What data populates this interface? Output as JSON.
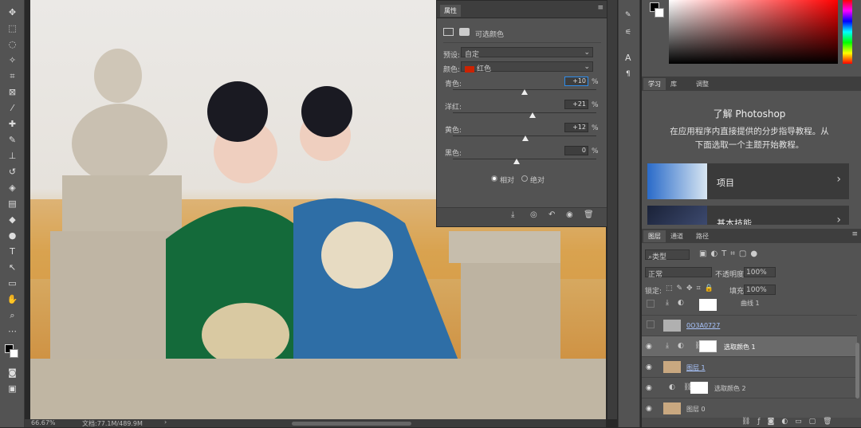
{
  "canvas": {
    "zoom": "66.67%",
    "doc": "文档:77.1M/489.9M"
  },
  "properties": {
    "tab": "属性",
    "title": "可选颜色",
    "preset_label": "预设:",
    "preset_value": "自定",
    "color_label": "颜色:",
    "color_value": "红色",
    "sliders": [
      {
        "label": "青色:",
        "value": "+10",
        "pct": "%"
      },
      {
        "label": "洋红:",
        "value": "+21",
        "pct": "%"
      },
      {
        "label": "黄色:",
        "value": "+12",
        "pct": "%"
      },
      {
        "label": "黑色:",
        "value": "0",
        "pct": "%"
      }
    ],
    "radio_relative": "相对",
    "radio_absolute": "绝对"
  },
  "learn": {
    "tabs": [
      "学习",
      "库",
      "调整"
    ],
    "heading": "了解 Photoshop",
    "desc_line1": "在应用程序内直接提供的分步指导教程。从",
    "desc_line2": "下面选取一个主题开始教程。",
    "cards": [
      {
        "label": "项目"
      },
      {
        "label": "基本技能"
      }
    ]
  },
  "layers": {
    "tabs": [
      "图层",
      "通道",
      "路径"
    ],
    "filter": "类型",
    "blend": "正常",
    "opacity_label": "不透明度:",
    "opacity": "100%",
    "lock_label": "锁定:",
    "fill_label": "填充:",
    "fill": "100%",
    "rows": [
      {
        "name": "曲线 1"
      },
      {
        "name": "0O3A0727"
      },
      {
        "name": "选取颜色 1"
      },
      {
        "name": "图层 1"
      },
      {
        "name": "选取颜色 2"
      },
      {
        "name": "图层 0"
      }
    ]
  },
  "colors": {
    "accent": "#2d8ceb",
    "red_swatch": "#cc2200"
  }
}
